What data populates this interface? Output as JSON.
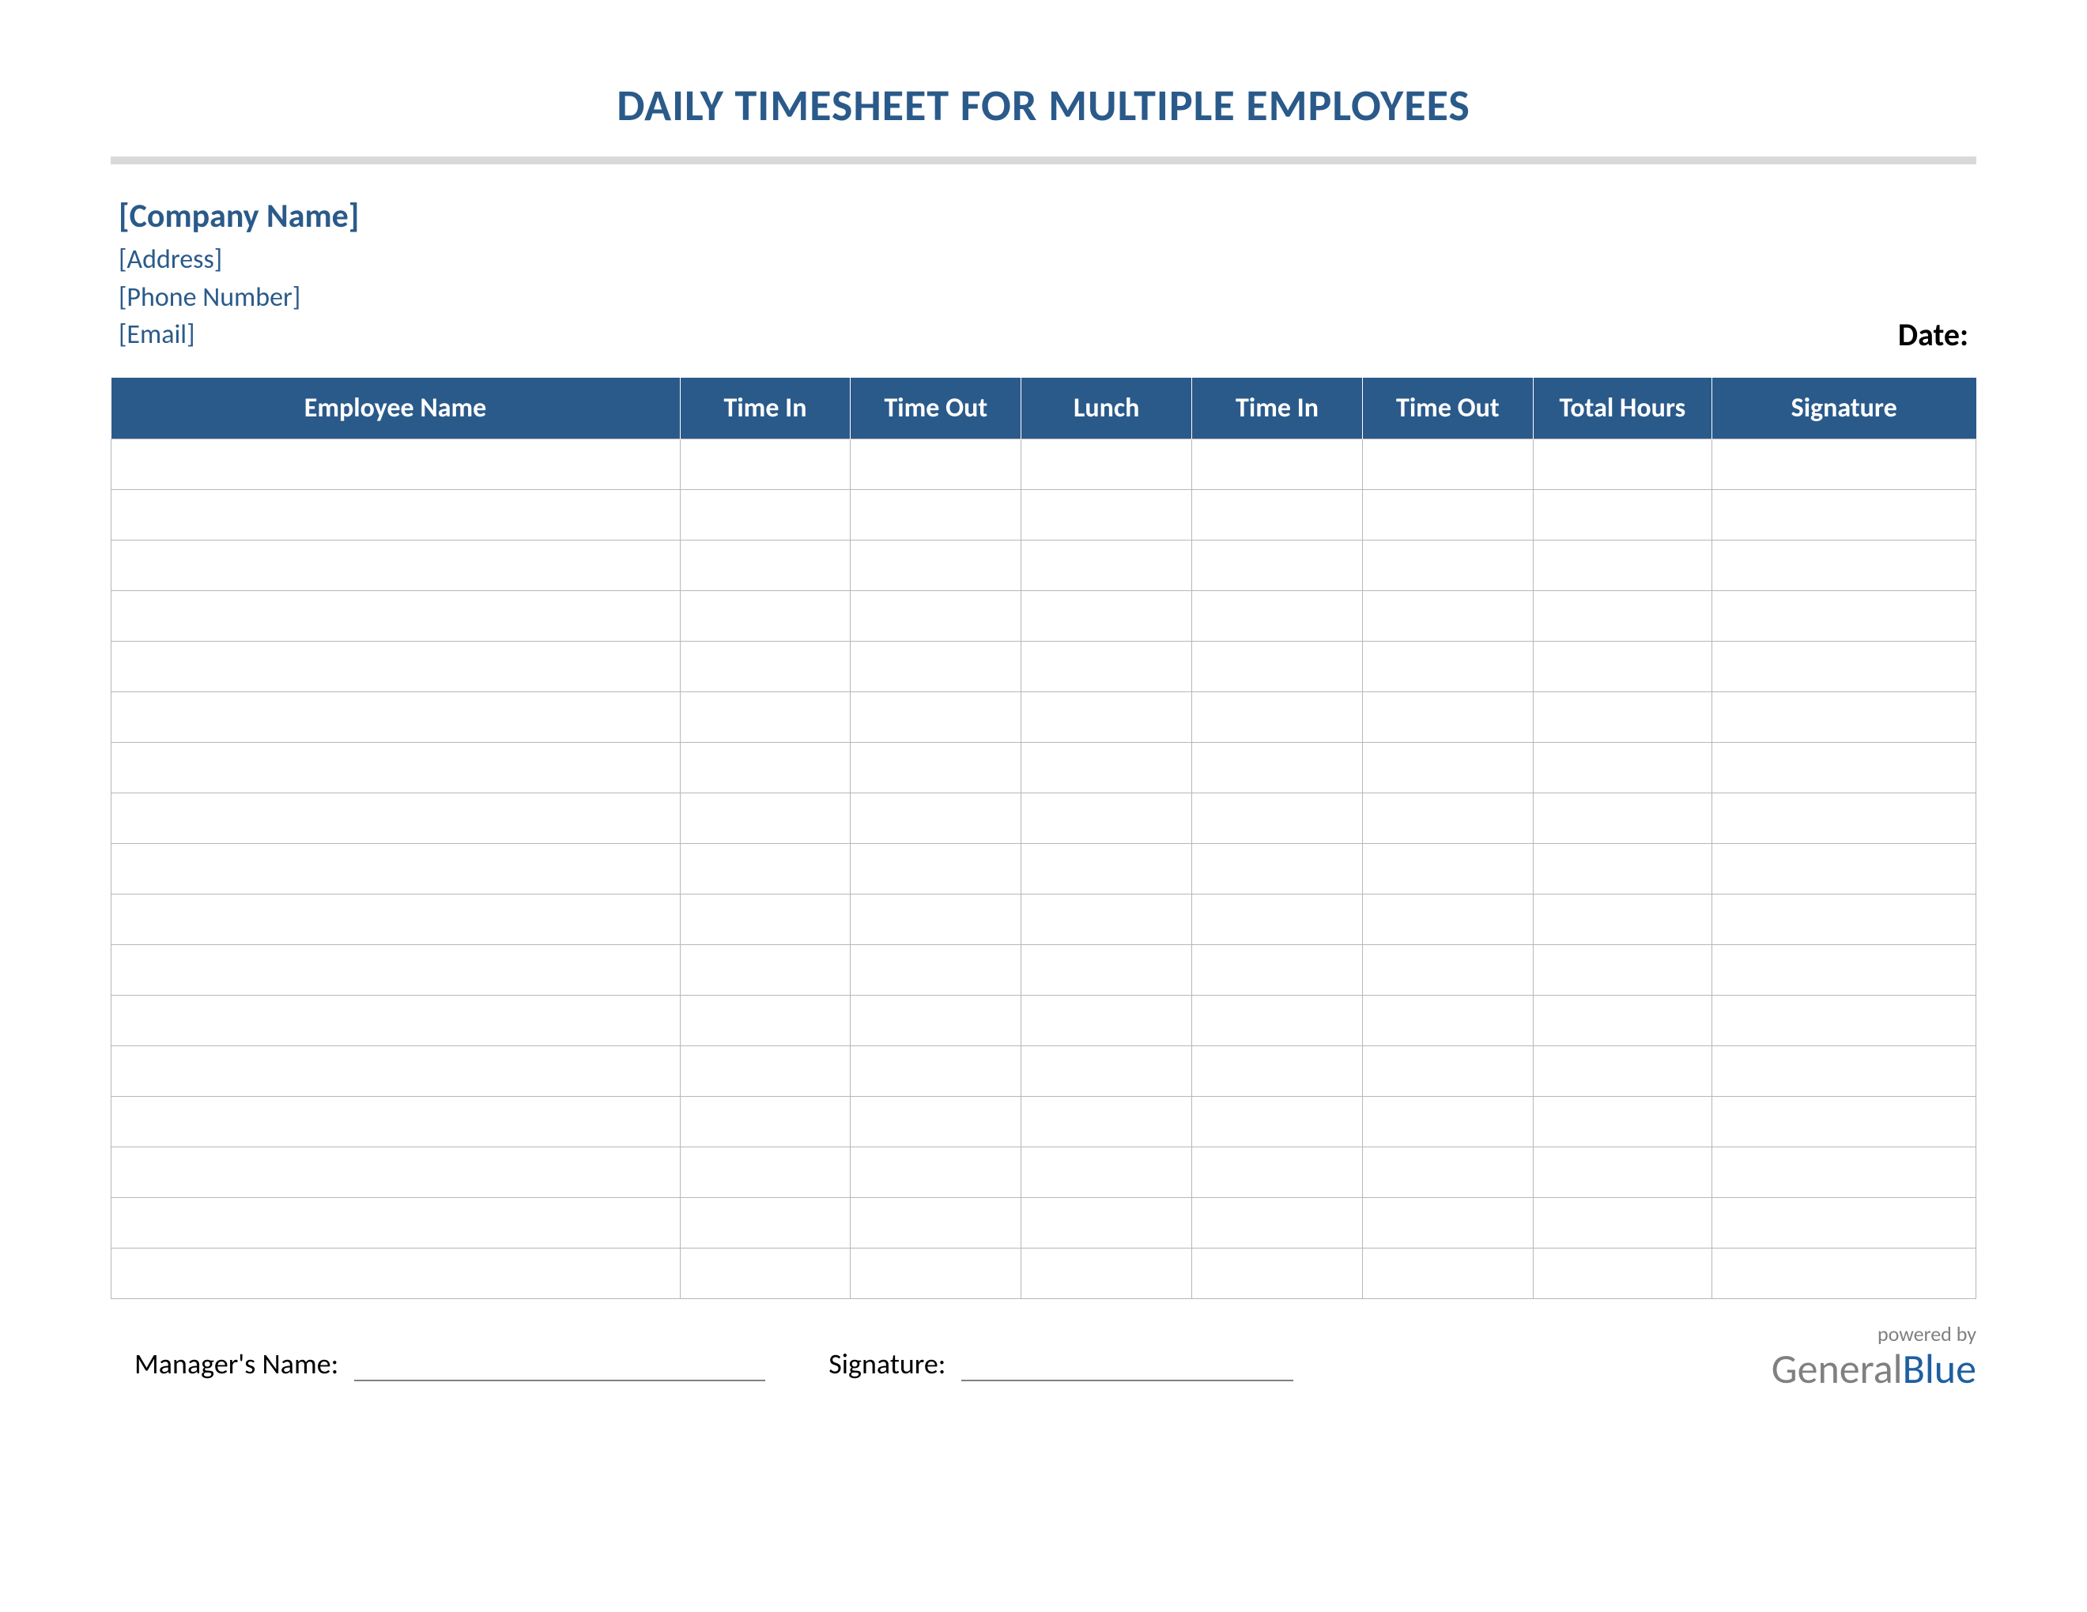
{
  "title": "DAILY TIMESHEET FOR MULTIPLE EMPLOYEES",
  "company": {
    "name": "[Company Name]",
    "address": "[Address]",
    "phone": "[Phone Number]",
    "email": "[Email]"
  },
  "date_label": "Date:",
  "table": {
    "headers": [
      "Employee Name",
      "Time In",
      "Time Out",
      "Lunch",
      "Time In",
      "Time Out",
      "Total Hours",
      "Signature"
    ],
    "row_count": 17
  },
  "footer": {
    "manager_label": "Manager's Name:",
    "signature_label": "Signature:",
    "powered_by": "powered by",
    "brand_general": "General",
    "brand_blue": "Blue"
  }
}
